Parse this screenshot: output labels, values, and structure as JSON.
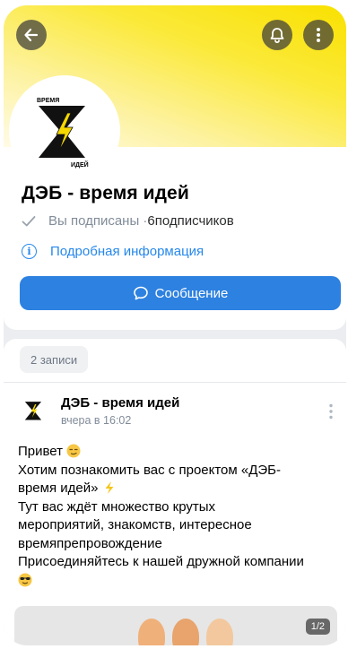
{
  "header": {
    "back_icon": "arrow-left-icon",
    "bell_icon": "bell-icon",
    "menu_icon": "more-vertical-icon",
    "logo_text_top": "ВРЕМЯ",
    "logo_text_bottom": "ИДЕЙ"
  },
  "group": {
    "name": "ДЭБ - время идей",
    "subscribed_label": "Вы подписаны · ",
    "subscribers_count": "6",
    "subscribers_label": " подписчиков",
    "info_label": "Подробная информация",
    "message_button": "Сообщение"
  },
  "posts": {
    "count_label": "2 записи",
    "post": {
      "author": "ДЭБ - время идей",
      "time": "вчера в 16:02",
      "lines": [
        "Привет",
        "Хотим познакомить вас с проектом «ДЭБ-",
        "время идей»",
        "Тут вас ждёт множество  крутых",
        "мероприятий, знакомств, интересное",
        "времяпрепровождение",
        "Присоединяйтесь к нашей дружной компании"
      ],
      "image_counter": "1/2"
    }
  },
  "colors": {
    "accent": "#2688eb",
    "button": "#2d81e0",
    "cover": "#f9e100"
  }
}
